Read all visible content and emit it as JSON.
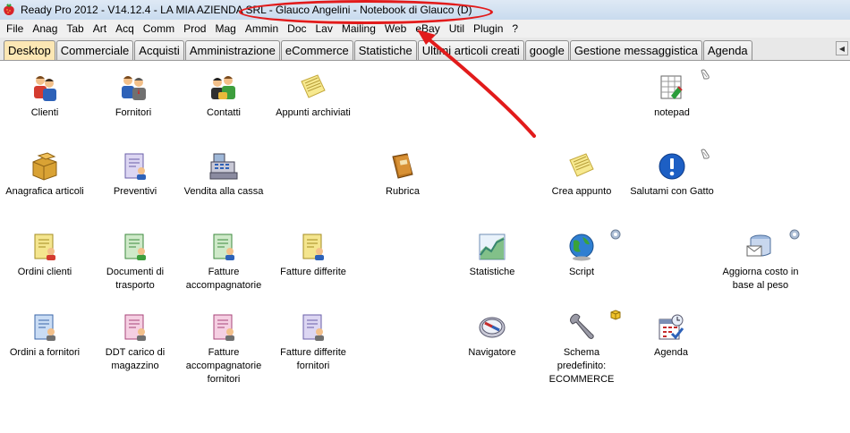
{
  "window": {
    "title": "Ready Pro 2012 - V14.12.4 - LA MIA AZIENDA SRL - Glauco Angelini - Notebook di Glauco (D)"
  },
  "menu": [
    "File",
    "Anag",
    "Tab",
    "Art",
    "Acq",
    "Comm",
    "Prod",
    "Mag",
    "Ammin",
    "Doc",
    "Lav",
    "Mailing",
    "Web",
    "eBay",
    "Util",
    "Plugin",
    "?"
  ],
  "tabs": [
    "Desktop",
    "Commerciale",
    "Acquisti",
    "Amministrazione",
    "eCommerce",
    "Statistiche",
    "Ultimi articoli creati",
    "google",
    "Gestione messaggistica",
    "Agenda"
  ],
  "active_tab": "Desktop",
  "desktop": {
    "clienti": "Clienti",
    "fornitori": "Fornitori",
    "contatti": "Contatti",
    "appunti_archiviati": "Appunti archiviati",
    "notepad": "notepad",
    "anagrafica_articoli": "Anagrafica articoli",
    "preventivi": "Preventivi",
    "vendita_cassa": "Vendita alla cassa",
    "rubrica": "Rubrica",
    "crea_appunto": "Crea appunto",
    "salutami": "Salutami con Gatto",
    "ordini_clienti": "Ordini clienti",
    "documenti_trasporto": "Documenti di trasporto",
    "fatture_accompagnatorie": "Fatture accompagnatorie",
    "fatture_differite": "Fatture differite",
    "statistiche": "Statistiche",
    "script": "Script",
    "aggiorna_costo": "Aggiorna costo in base al peso",
    "ordini_fornitori": "Ordini a fornitori",
    "ddt_carico": "DDT carico di magazzino",
    "fatture_acc_fornitori": "Fatture accompagnatorie fornitori",
    "fatture_diff_fornitori": "Fatture differite fornitori",
    "navigatore": "Navigatore",
    "schema_predefinito": "Schema predefinito: ECOMMERCE",
    "agenda": "Agenda"
  },
  "colors": {
    "annotation": "#e21b1b",
    "active_tab": "#fce7b4"
  }
}
